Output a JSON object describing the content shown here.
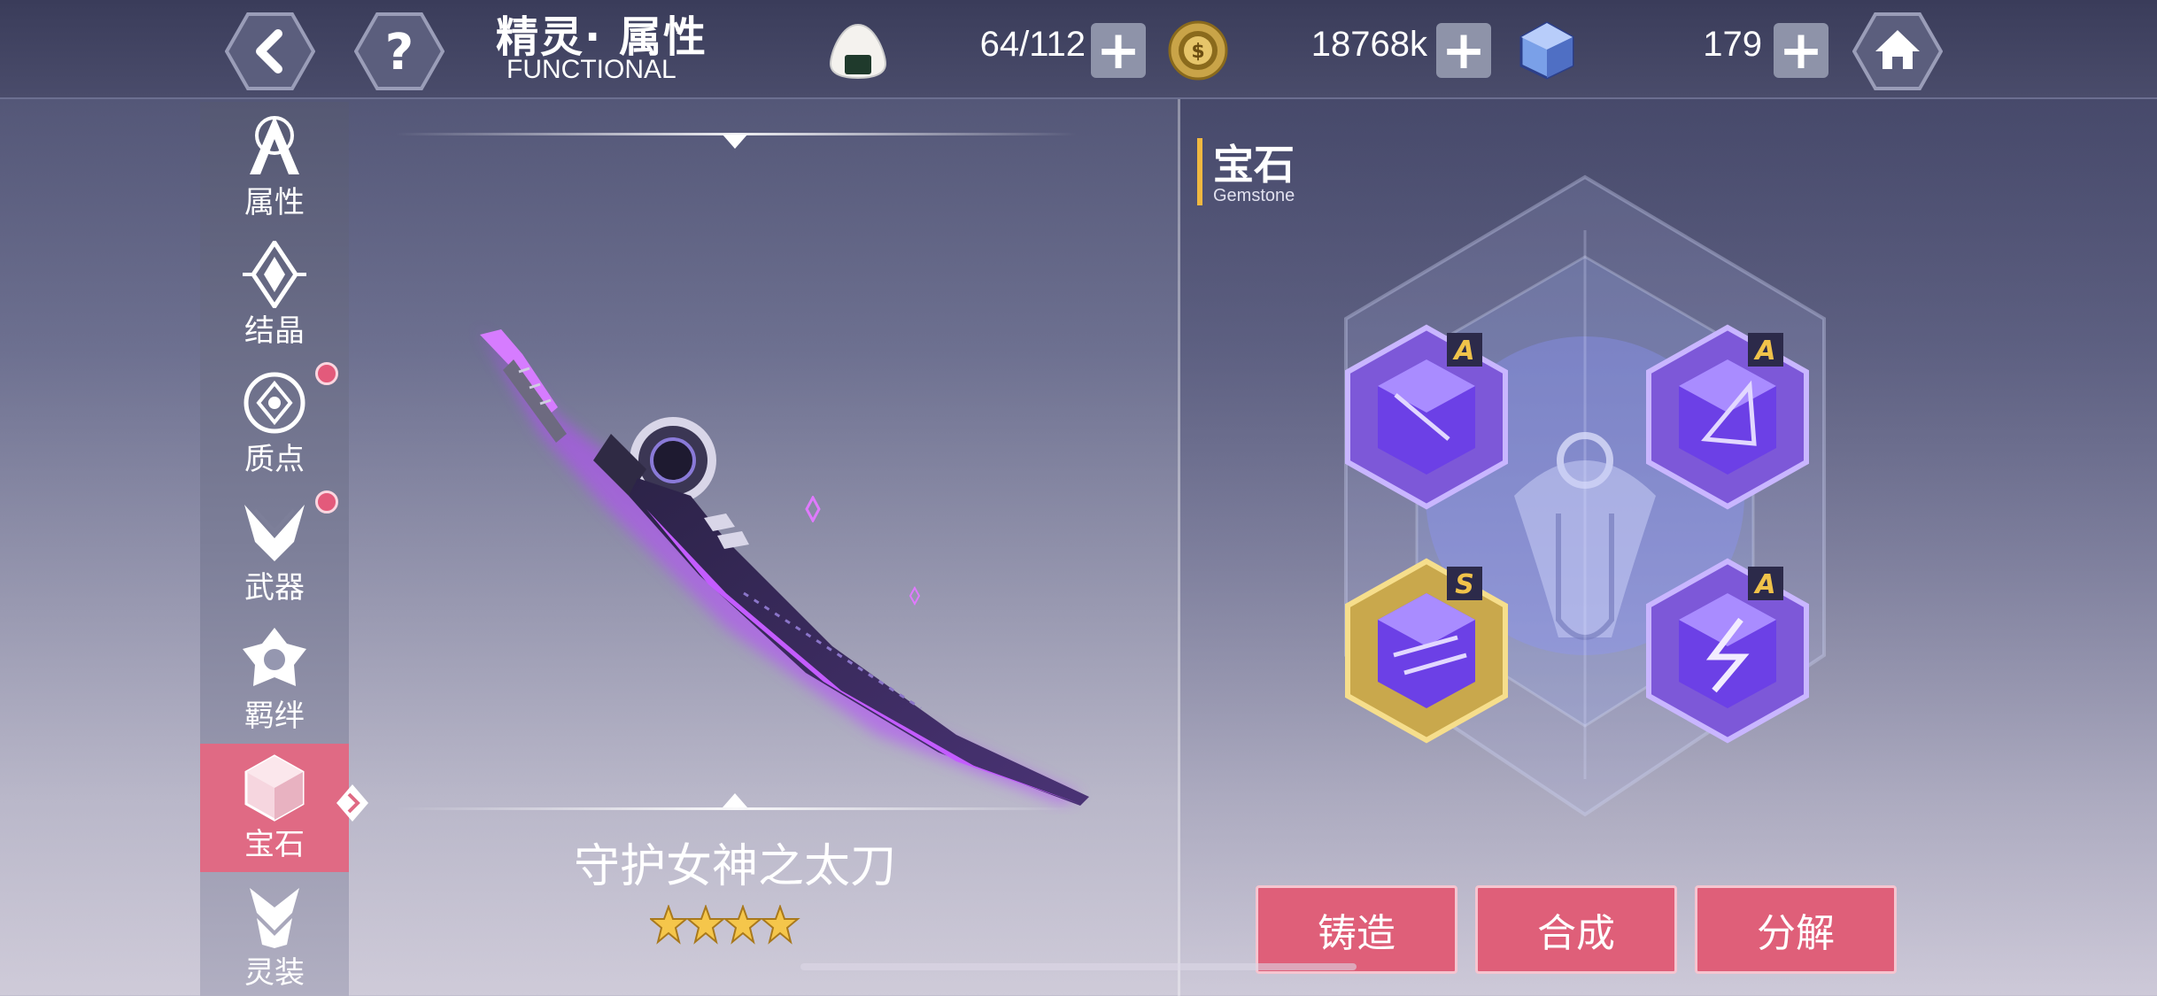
{
  "header": {
    "title_cn": "精灵· 属性",
    "title_en": "FUNCTIONAL",
    "back_icon": "chevron-left-icon",
    "help_icon": "question-icon",
    "home_icon": "home-icon"
  },
  "resources": [
    {
      "name": "riceball",
      "icon": "riceball-icon",
      "value": "64/112"
    },
    {
      "name": "coin",
      "icon": "coin-icon",
      "value": "18768k"
    },
    {
      "name": "crystal",
      "icon": "crystal-cube-icon",
      "value": "179"
    }
  ],
  "sidebar": {
    "items": [
      {
        "label": "属性",
        "icon": "attribute-icon",
        "badge": false
      },
      {
        "label": "结晶",
        "icon": "crystal-icon",
        "badge": false
      },
      {
        "label": "质点",
        "icon": "particle-icon",
        "badge": true
      },
      {
        "label": "武器",
        "icon": "weapon-icon",
        "badge": true
      },
      {
        "label": "羁绊",
        "icon": "bond-icon",
        "badge": false
      },
      {
        "label": "宝石",
        "icon": "gemstone-icon",
        "badge": false,
        "active": true
      },
      {
        "label": "灵装",
        "icon": "spirit-gear-icon",
        "badge": false
      }
    ]
  },
  "weapon": {
    "name": "守护女神之太刀",
    "stars": 4,
    "stars_max": 4
  },
  "gem_panel": {
    "title": "宝石",
    "subtitle": "Gemstone",
    "gems": [
      {
        "slot": "top-left",
        "grade": "A",
        "frame": "purple"
      },
      {
        "slot": "top-right",
        "grade": "A",
        "frame": "purple"
      },
      {
        "slot": "bottom-left",
        "grade": "S",
        "frame": "gold"
      },
      {
        "slot": "bottom-right",
        "grade": "A",
        "frame": "purple"
      }
    ]
  },
  "actions": {
    "forge": "铸造",
    "combine": "合成",
    "decompose": "分解"
  },
  "colors": {
    "accent_pink": "#df5f79",
    "badge_red": "#e35a7b",
    "gold": "#f0b840",
    "gem_purple": "#8a5cf0"
  }
}
